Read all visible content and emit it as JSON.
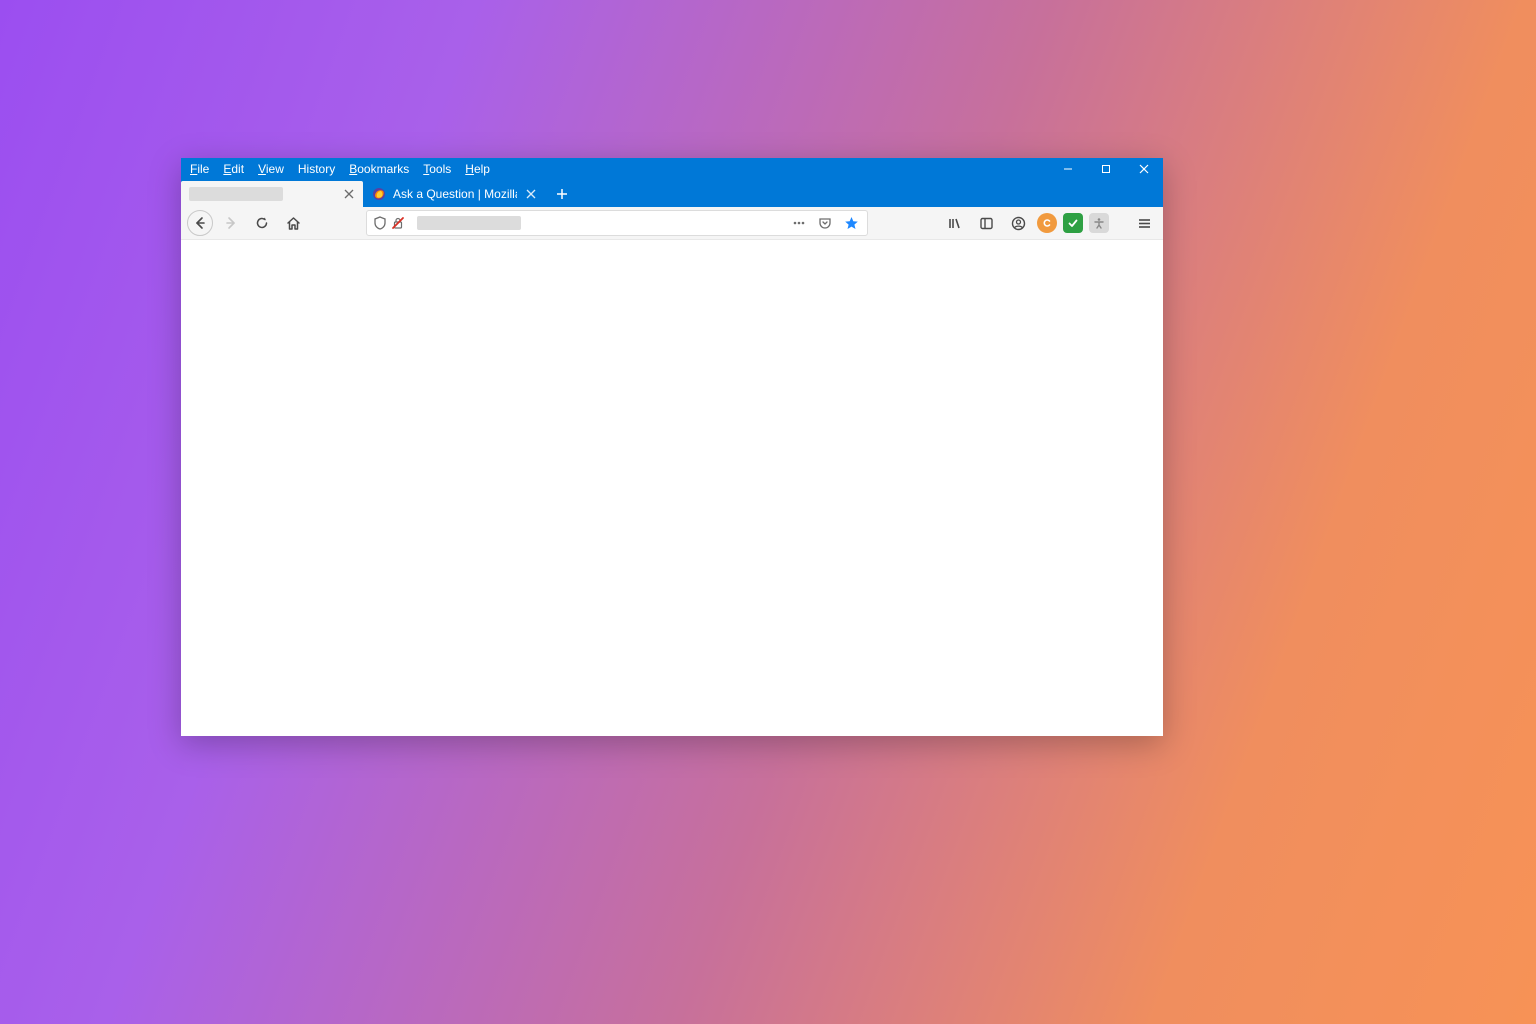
{
  "menu": {
    "file": "File",
    "edit": "Edit",
    "view": "View",
    "history": "History",
    "bookmarks": "Bookmarks",
    "tools": "Tools",
    "help": "Help"
  },
  "tabs": {
    "tab2_label": "Ask a Question | Mozilla Suppo"
  },
  "colors": {
    "titlebar_blue": "#0078d7",
    "star_blue": "#1e88ff",
    "ext_orange": "#f19a3e",
    "ext_green": "#2ea043"
  }
}
